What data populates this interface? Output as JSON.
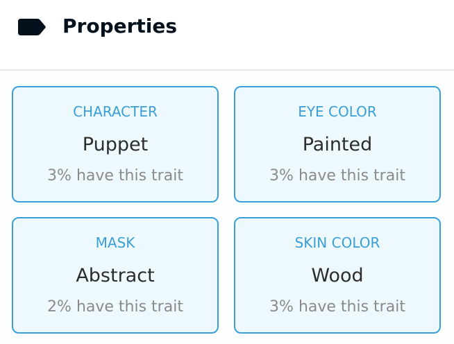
{
  "panel": {
    "title": "Properties",
    "icon": "tag-icon",
    "text_color": "#04111d"
  },
  "colors": {
    "accent": "#3a9fd8",
    "card_background": "#eef9fd",
    "value_text": "#2c2c2c",
    "rarity_text": "#8a8a8a"
  },
  "properties": [
    {
      "type": "CHARACTER",
      "value": "Puppet",
      "rarity": "3% have this trait"
    },
    {
      "type": "EYE COLOR",
      "value": "Painted",
      "rarity": "3% have this trait"
    },
    {
      "type": "MASK",
      "value": "Abstract",
      "rarity": "2% have this trait"
    },
    {
      "type": "SKIN COLOR",
      "value": "Wood",
      "rarity": "3% have this trait"
    }
  ]
}
